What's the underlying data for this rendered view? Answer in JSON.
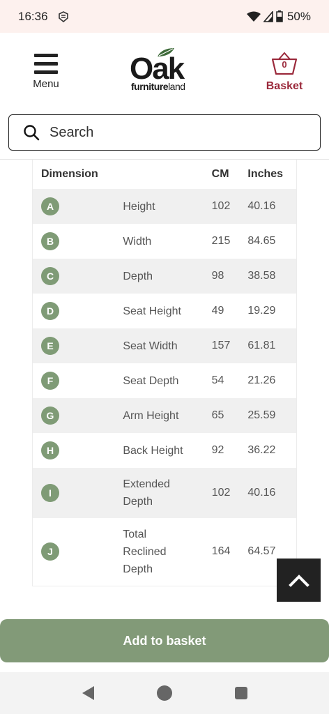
{
  "status_bar": {
    "time": "16:36",
    "battery": "50%"
  },
  "header": {
    "menu_label": "Menu",
    "logo": {
      "main": "Oak",
      "sub_bold": "furniture",
      "sub_light": "land"
    },
    "basket_label": "Basket",
    "basket_count": "0",
    "brand_color": "#9b2a3c"
  },
  "search": {
    "placeholder": "Search"
  },
  "dimensions_table": {
    "headers": {
      "dimension": "Dimension",
      "cm": "CM",
      "inches": "Inches"
    },
    "badge_color": "#7f9b76",
    "rows": [
      {
        "letter": "A",
        "name": "Height",
        "cm": "102",
        "inches": "40.16"
      },
      {
        "letter": "B",
        "name": "Width",
        "cm": "215",
        "inches": "84.65"
      },
      {
        "letter": "C",
        "name": "Depth",
        "cm": "98",
        "inches": "38.58"
      },
      {
        "letter": "D",
        "name": "Seat Height",
        "cm": "49",
        "inches": "19.29"
      },
      {
        "letter": "E",
        "name": "Seat Width",
        "cm": "157",
        "inches": "61.81"
      },
      {
        "letter": "F",
        "name": "Seat Depth",
        "cm": "54",
        "inches": "21.26"
      },
      {
        "letter": "G",
        "name": "Arm Height",
        "cm": "65",
        "inches": "25.59"
      },
      {
        "letter": "H",
        "name": "Back Height",
        "cm": "92",
        "inches": "36.22"
      },
      {
        "letter": "I",
        "name": "Extended Depth",
        "cm": "102",
        "inches": "40.16"
      },
      {
        "letter": "J",
        "name": "Total Reclined Depth",
        "cm": "164",
        "inches": "64.57"
      }
    ]
  },
  "actions": {
    "add_to_basket": "Add to basket",
    "button_color": "#829a78"
  },
  "icons": {
    "menu": "hamburger-icon",
    "basket": "basket-icon",
    "search": "search-icon",
    "scroll_top": "chevron-up-icon",
    "nav_back": "back-triangle-icon",
    "nav_home": "home-circle-icon",
    "nav_recent": "recent-square-icon"
  }
}
